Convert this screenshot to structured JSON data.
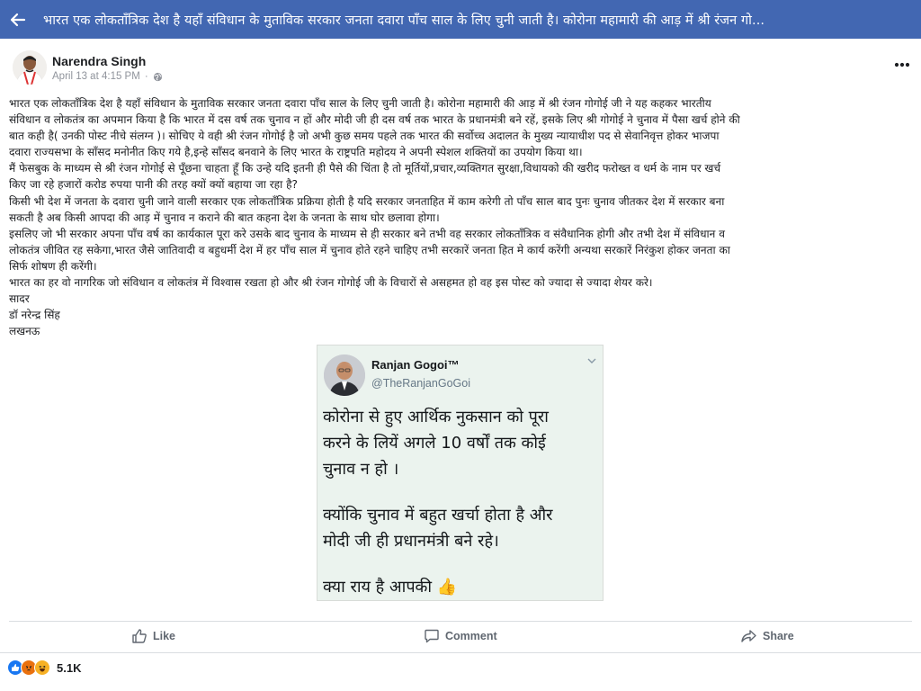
{
  "topbar": {
    "title": "भारत एक लोकताँत्रिक देश है यहाँ संविधान के मुताविक सरकार जनता दवारा पाँच साल के लिए चुनी जाती है। कोरोना महामारी की आड़ में श्री रंजन गो..."
  },
  "post": {
    "author": "Narendra Singh",
    "timestamp": "April 13 at 4:15 PM",
    "separator": "·",
    "privacy_icon": "globe-icon",
    "more_icon": "more-dots-icon",
    "lines": [
      "भारत एक लोकताँत्रिक देश है यहाँ संविधान के मुताविक सरकार जनता दवारा पाँच साल के लिए चुनी जाती है। कोरोना महामारी की आड़ में श्री रंजन गोगोई जी ने यह कहकर भारतीय",
      "संविधान व लोकतंत्र का अपमान किया है कि भारत में दस वर्ष तक चुनाव न हों और मोदी जी ही दस वर्ष तक भारत के प्रधानमंत्री बने रहें, इसके लिए श्री गोगोई ने चुनाव में पैसा खर्च होने की",
      "बात कही है( उनकी पोस्ट नीचे संलग्न )। सोचिए ये वही श्री रंजन गोगोई है जो अभी कुछ समय पहले तक भारत की सर्वोच्च अदालत के मुख्य न्यायाधीश पद से सेवानिवृत्त होकर भाजपा",
      "दवारा राज्यसभा के साँसद मनोनीत किए गये है,इन्हे साँसद बनवाने के लिए भारत के राष्ट्रपति महोदय ने अपनी स्पेशल शक्तियों का उपयोग किया था।",
      "मैं फेसबुक के माध्यम से श्री रंजन गोगोई से पूँछना चाहता हूँ कि उन्हे यदि इतनी ही पैसे की चिंता है तो मूर्तियों,प्रचार,व्यक्तिगत सुरक्षा,विधायको की खरीद फरोख्त व धर्म के नाम पर खर्च",
      "किए जा रहे हजारों करोड रुपया पानी की तरह क्यों क्यों बहाया जा रहा है?",
      "किसी भी देश में जनता के दवारा चुनी जाने वाली सरकार एक लोकताँत्रिक प्रक्रिया होती है यदि सरकार जनताहित में काम करेगी तो पाँच साल बाद पुनः चुनाव जीतकर देश में सरकार बना",
      "सकती है अब किसी आपदा की आड़ में चुनाव न कराने की बात कहना देश के जनता के साथ घोर छलावा होगा।",
      "इसलिए जो भी सरकार अपना पाँच वर्ष का कार्यकाल पूरा करे उसके बाद चुनाव के माध्यम से ही सरकार बने तभी वह सरकार लोकताँत्रिक व संवैधानिक होगी और तभी देश में संविधान व",
      "लोकतंत्र जीवित रह सकेगा,भारत जैसे जातिवादी व बहुधर्मी देश में हर पाँच साल में चुनाव होते रहने चाहिए तभी सरकारें जनता हित मे कार्य करेंगी अन्यथा सरकारें निरंकुश होकर जनता का",
      "सिर्फ शोषण ही करेंगी।",
      "भारत का हर वो नागरिक जो संविधान व लोकतंत्र में विश्वास रखता हो और श्री रंजन गोगोई जी के विचारों से असहमत हो वह इस पोस्ट को ज्यादा से ज्यादा शेयर करे।",
      "सादर",
      "डॉ नरेन्द्र सिंह",
      "लखनऊ"
    ]
  },
  "tweet": {
    "name": "Ranjan Gogoi™",
    "handle": "@TheRanjanGoGoi",
    "paragraph1": [
      "कोरोना से हुए आर्थिक नुकसान को पूरा",
      "करने के लियें अगले 10 वर्षों तक कोई",
      "चुनाव न हो ।"
    ],
    "paragraph2": [
      "क्योंकि चुनाव में बहुत खर्चा होता है और",
      "मोदी जी ही प्रधानमंत्री बने रहे।"
    ],
    "paragraph3": "क्या राय है आपकी",
    "emoji": "👍"
  },
  "actions": {
    "like": "Like",
    "comment": "Comment",
    "share": "Share"
  },
  "reactions": {
    "count": "5.1K",
    "icons": [
      "like-reaction-icon",
      "angry-reaction-icon",
      "haha-reaction-icon"
    ]
  },
  "colors": {
    "topbar": "#4267b2",
    "like_reaction": "#1877f2",
    "angry_reaction": "#e9710f",
    "haha_reaction": "#f7b125"
  }
}
